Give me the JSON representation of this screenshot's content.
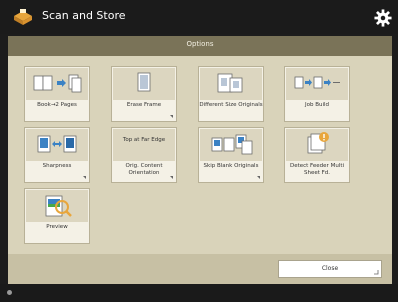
{
  "app": {
    "title": "Scan and Store"
  },
  "header": {
    "title": "Options"
  },
  "tiles": [
    {
      "label": "Book→2 Pages",
      "icon": "book-split-icon"
    },
    {
      "label": "Erase Frame",
      "icon": "erase-frame-icon"
    },
    {
      "label": "Different Size Originals",
      "icon": "different-size-originals-icon"
    },
    {
      "label": "Job Build",
      "icon": "job-build-icon"
    },
    {
      "label": "Sharpness",
      "icon": "sharpness-icon"
    },
    {
      "label": "Orig. Content Orientation",
      "icon_text": "Top at Far Edge"
    },
    {
      "label": "Skip Blank Originals",
      "icon": "skip-blank-icon"
    },
    {
      "label": "Detect Feeder Multi Sheet Fd.",
      "icon": "detect-feeder-icon"
    },
    {
      "label": "Preview",
      "icon": "preview-icon"
    }
  ],
  "footer": {
    "close_label": "Close"
  },
  "colors": {
    "accent": "#e8a63c",
    "header": "#7a7358",
    "panel": "#d9d3ba"
  }
}
